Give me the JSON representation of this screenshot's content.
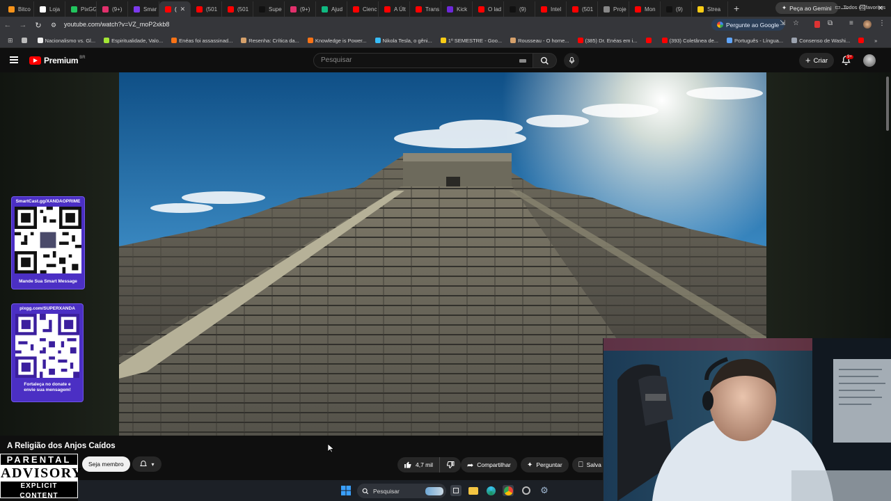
{
  "browser": {
    "tabs": [
      {
        "label": "Bitco",
        "color": "#f7931a"
      },
      {
        "label": "Loja",
        "color": "#ffffff"
      },
      {
        "label": "PixGG",
        "color": "#22c55e"
      },
      {
        "label": "(9+)",
        "color": "#e1306c"
      },
      {
        "label": "Smar",
        "color": "#7c3aed"
      },
      {
        "label": "(",
        "color": "#ff0000",
        "active": true
      },
      {
        "label": "(501",
        "color": "#ff0000"
      },
      {
        "label": "(501",
        "color": "#ff0000"
      },
      {
        "label": "Supe",
        "color": "#111111"
      },
      {
        "label": "(9+)",
        "color": "#e1306c"
      },
      {
        "label": "Ajud",
        "color": "#10b981"
      },
      {
        "label": "Cienc",
        "color": "#ff0000"
      },
      {
        "label": "A Últ",
        "color": "#ff0000"
      },
      {
        "label": "Trans",
        "color": "#ff0000"
      },
      {
        "label": "Kick",
        "color": "#6d28d9"
      },
      {
        "label": "O lad",
        "color": "#ff0000"
      },
      {
        "label": "(9)",
        "color": "#111111"
      },
      {
        "label": "Intel",
        "color": "#ff0000"
      },
      {
        "label": "(501",
        "color": "#ff0000"
      },
      {
        "label": "Proje",
        "color": "#888888"
      },
      {
        "label": "Mon",
        "color": "#ff0000"
      },
      {
        "label": "(9)",
        "color": "#111111"
      },
      {
        "label": "Strea",
        "color": "#facc15"
      }
    ],
    "new_tab": "+",
    "gemini_button": "Peça ao Gemini",
    "url": "youtube.com/watch?v=VZ_moP2xkb8",
    "ask_google": "Pergunte ao Google",
    "bookmarks": [
      {
        "label": "",
        "color": "#bbbbbb"
      },
      {
        "label": "Nacionalismo vs. Gl...",
        "color": "#eeeeee"
      },
      {
        "label": "Espiritualidade, Valo...",
        "color": "#a3e635"
      },
      {
        "label": "Enéas foi assassinad...",
        "color": "#f97316"
      },
      {
        "label": "Resenha: Crítica da...",
        "color": "#d6a16b"
      },
      {
        "label": "Knowledge is Power...",
        "color": "#f97316"
      },
      {
        "label": "Nikola Tesla, o gêni...",
        "color": "#38bdf8"
      },
      {
        "label": "1º SEMESTRE - Goo...",
        "color": "#facc15"
      },
      {
        "label": "Rousseau - O home...",
        "color": "#d6a16b"
      },
      {
        "label": "(385) Dr. Enéas em i...",
        "color": "#ff0000"
      },
      {
        "label": "",
        "color": "#ff0000"
      },
      {
        "label": "(393) Coletânea de...",
        "color": "#ff0000"
      },
      {
        "label": "Português - Língua...",
        "color": "#60a5fa"
      },
      {
        "label": "Consenso de Washi...",
        "color": "#9ca3af"
      },
      {
        "label": "",
        "color": "#ff0000"
      }
    ],
    "all_bookmarks": "Todos os favoritos"
  },
  "youtube": {
    "logo_text": "Premium",
    "region": "BR",
    "search_placeholder": "Pesquisar",
    "create_label": "Criar",
    "notifications_badge": "9+",
    "video_title": "A Religião dos Anjos Caídos",
    "member_button": "Seja membro",
    "likes": "4,7 mil",
    "share_label": "Compartilhar",
    "ask_label": "Perguntar",
    "save_label": "Salva"
  },
  "overlays": {
    "card1_header": "SmartCast.gg/XANDAOPRIME",
    "card1_footer": "Mande Sua Smart Message",
    "card2_header": "pixgg.com/SUPERXANDA",
    "card2_footer_line1": "Fortaleça no donate e",
    "card2_footer_line2": "envie sua mensagem!",
    "advisory_line1": "PARENTAL",
    "advisory_line2": "ADVISORY",
    "advisory_line3": "EXPLICIT CONTENT"
  },
  "taskbar": {
    "search_label": "Pesquisar"
  }
}
